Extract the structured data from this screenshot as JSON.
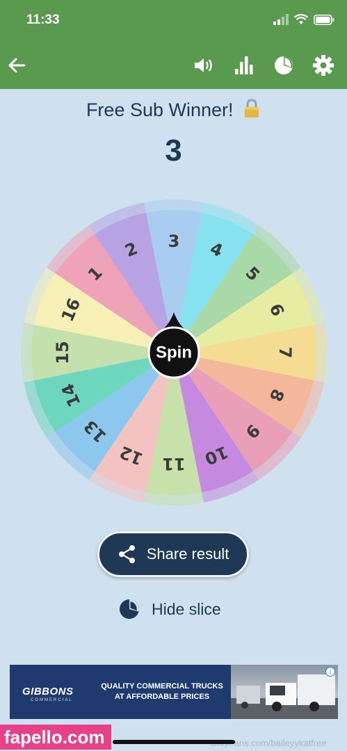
{
  "status_bar": {
    "time": "11:33"
  },
  "app_bar": {
    "back_icon": "arrow-left-icon",
    "actions": [
      "volume-icon",
      "stats-icon",
      "pie-chart-icon",
      "gear-icon"
    ],
    "background": "#5a9a4f"
  },
  "wheel": {
    "title": "Free Sub Winner!",
    "lock_icon": "lock-icon",
    "result": "3",
    "center_label": "Spin",
    "slices": [
      {
        "label": "3",
        "color": "#a9cdf0"
      },
      {
        "label": "4",
        "color": "#86e2ef"
      },
      {
        "label": "5",
        "color": "#a9d9a6"
      },
      {
        "label": "6",
        "color": "#e6eda2"
      },
      {
        "label": "7",
        "color": "#f4dd92"
      },
      {
        "label": "8",
        "color": "#f4b79c"
      },
      {
        "label": "9",
        "color": "#e99fb8"
      },
      {
        "label": "10",
        "color": "#c58ae0"
      },
      {
        "label": "11",
        "color": "#c8e0a9"
      },
      {
        "label": "12",
        "color": "#f2c3c0"
      },
      {
        "label": "13",
        "color": "#8cc7ed"
      },
      {
        "label": "14",
        "color": "#6fd6be"
      },
      {
        "label": "15",
        "color": "#c4e0ac"
      },
      {
        "label": "16",
        "color": "#f6efb6"
      },
      {
        "label": "1",
        "color": "#eea3b8"
      },
      {
        "label": "2",
        "color": "#b7a3e4"
      }
    ]
  },
  "actions": {
    "share_label": "Share result",
    "hide_slice_label": "Hide slice",
    "accent": "#1f3856"
  },
  "ad": {
    "brand": "GIBBONS",
    "brand_sub": "COMMERCIAL",
    "line1": "QUALITY COMMERCIAL TRUCKS",
    "line2": "AT AFFORDABLE PRICES",
    "info": "i"
  },
  "watermark": {
    "badge": "fapello.com",
    "text": "OnlyFans.com/baileyykatfree"
  }
}
